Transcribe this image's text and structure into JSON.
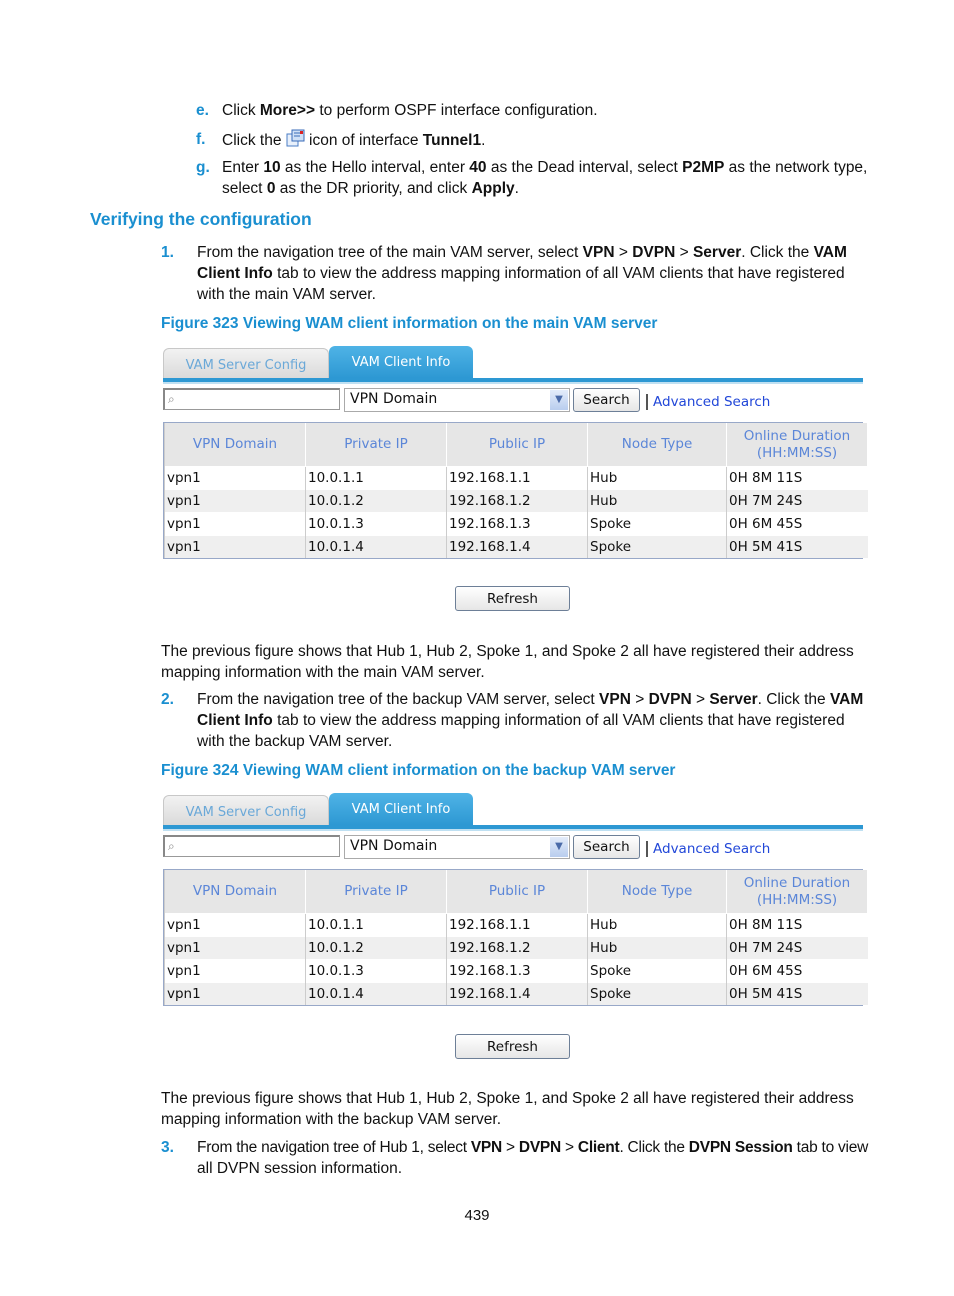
{
  "steps_top": [
    {
      "marker": "e.",
      "parts": [
        {
          "t": "Click "
        },
        {
          "b": "More>>"
        },
        {
          "t": " to perform OSPF interface configuration."
        }
      ]
    },
    {
      "marker": "f.",
      "pre": "Click the ",
      "icon": "interface-edit-icon",
      "post_parts": [
        {
          "t": " icon of interface "
        },
        {
          "b": "Tunnel1"
        },
        {
          "t": "."
        }
      ]
    },
    {
      "marker": "g.",
      "line1": [
        {
          "t": "Enter "
        },
        {
          "b": "10"
        },
        {
          "t": " as the Hello interval, enter "
        },
        {
          "b": "40"
        },
        {
          "t": " as the Dead interval, select "
        },
        {
          "b": "P2MP"
        },
        {
          "t": " as the network type,"
        }
      ],
      "line2": [
        {
          "t": "select "
        },
        {
          "b": "0"
        },
        {
          "t": " as the DR priority, and click "
        },
        {
          "b": "Apply"
        },
        {
          "t": "."
        }
      ]
    }
  ],
  "section_heading": "Verifying the configuration",
  "step1": {
    "marker": "1.",
    "lines": [
      [
        {
          "t": "From the navigation tree of the main VAM server, select "
        },
        {
          "b": "VPN"
        },
        {
          "t": " > "
        },
        {
          "b": "DVPN"
        },
        {
          "t": " > "
        },
        {
          "b": "Server"
        },
        {
          "t": ". Click the "
        },
        {
          "b": "VAM"
        }
      ],
      [
        {
          "b": "Client Info"
        },
        {
          "t": " tab to view the address mapping information of all VAM clients that have registered"
        }
      ],
      [
        {
          "t": "with the main VAM server."
        }
      ]
    ]
  },
  "figure1_caption": "Figure 323 Viewing WAM client information on the main VAM server",
  "para1": [
    "The previous figure shows that Hub 1, Hub 2, Spoke 1, and Spoke 2 all have registered their address",
    "mapping information with the main VAM server."
  ],
  "step2": {
    "marker": "2.",
    "lines": [
      [
        {
          "t": "From the navigation tree of the backup VAM server, select "
        },
        {
          "b": "VPN"
        },
        {
          "t": " > "
        },
        {
          "b": "DVPN"
        },
        {
          "t": " > "
        },
        {
          "b": "Server"
        },
        {
          "t": ". Click the "
        },
        {
          "b": "VAM"
        }
      ],
      [
        {
          "b": "Client Info"
        },
        {
          "t": " tab to view the address mapping information of all VAM clients that have registered"
        }
      ],
      [
        {
          "t": "with the backup VAM server."
        }
      ]
    ]
  },
  "figure2_caption": "Figure 324 Viewing WAM client information on the backup VAM server",
  "para2": [
    "The previous figure shows that Hub 1, Hub 2, Spoke 1, and Spoke 2 all have registered their address",
    "mapping information with the backup VAM server."
  ],
  "step3": {
    "marker": "3.",
    "lines": [
      [
        {
          "t": "From the navigation tree of Hub 1, select "
        },
        {
          "b": "VPN"
        },
        {
          "t": " > "
        },
        {
          "b": "DVPN"
        },
        {
          "t": " > "
        },
        {
          "b": "Client"
        },
        {
          "t": ". Click the "
        },
        {
          "b": "DVPN Session"
        },
        {
          "t": " tab to view"
        }
      ],
      [
        {
          "t": "all DVPN session information."
        }
      ]
    ]
  },
  "widget": {
    "tabs": [
      "VAM Server Config",
      "VAM Client Info"
    ],
    "active_tab": "VAM Client Info",
    "search_value": "",
    "select_value": "VPN Domain",
    "search_button": "Search",
    "advanced_search": "Advanced Search",
    "columns": [
      "VPN Domain",
      "Private IP",
      "Public IP",
      "Node Type",
      "Online Duration\n(HH:MM:SS)"
    ],
    "column_header_lines": [
      [
        "VPN Domain"
      ],
      [
        "Private IP"
      ],
      [
        "Public IP"
      ],
      [
        "Node Type"
      ],
      [
        "Online Duration",
        "(HH:MM:SS)"
      ]
    ],
    "rows": [
      [
        "vpn1",
        "10.0.1.1",
        "192.168.1.1",
        "Hub",
        "0H 8M 11S"
      ],
      [
        "vpn1",
        "10.0.1.2",
        "192.168.1.2",
        "Hub",
        "0H 7M 24S"
      ],
      [
        "vpn1",
        "10.0.1.3",
        "192.168.1.3",
        "Spoke",
        "0H 6M 45S"
      ],
      [
        "vpn1",
        "10.0.1.4",
        "192.168.1.4",
        "Spoke",
        "0H 5M 41S"
      ]
    ],
    "refresh_button": "Refresh"
  },
  "page_number": "439"
}
